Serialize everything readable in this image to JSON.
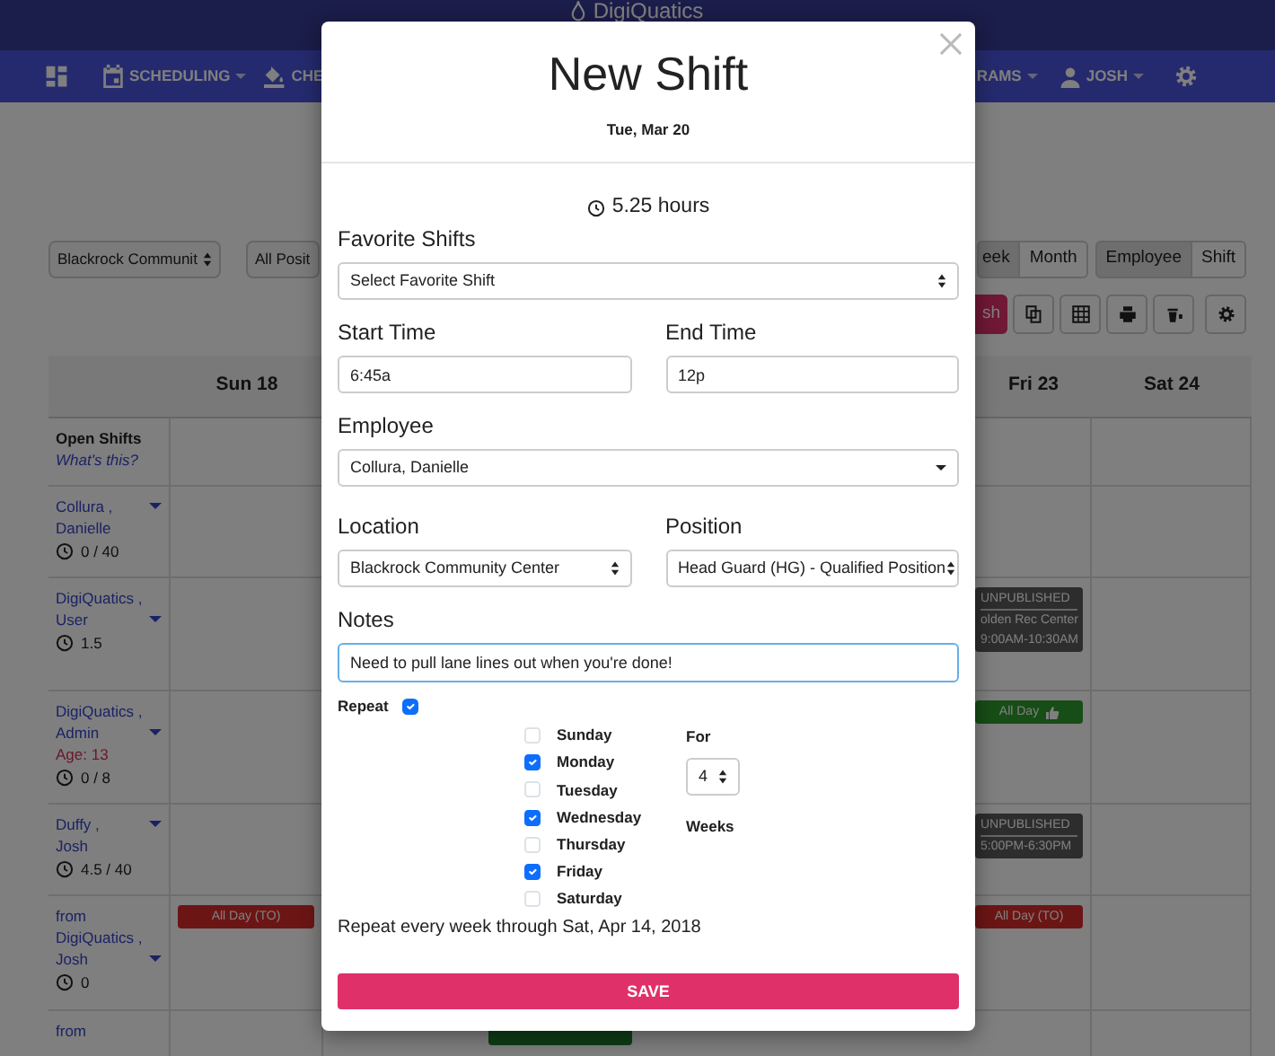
{
  "brand": "DigiQuatics",
  "nav": {
    "left": [
      {
        "label": "SCHEDULING",
        "dropdown": true
      },
      {
        "label": "CHE",
        "dropdown": false
      }
    ],
    "right": [
      {
        "label": "RAMS",
        "dropdown": true
      },
      {
        "label": "JOSH",
        "dropdown": true
      }
    ]
  },
  "filters": [
    {
      "value": "Blackrock Communit"
    },
    {
      "value": "All Posit"
    }
  ],
  "views": [
    {
      "label": "eek",
      "selected": true
    },
    {
      "label": "Month",
      "selected": false
    }
  ],
  "modes": [
    {
      "label": "Employee",
      "selected": true
    },
    {
      "label": "Shift",
      "selected": false
    }
  ],
  "publish": "sh",
  "table": {
    "columns": [
      "Sun 18",
      "Fri 23",
      "Sat 24"
    ],
    "open_shifts": {
      "label": "Open Shifts",
      "link": "What's this?"
    },
    "rows": [
      {
        "last": "Collura ,",
        "first": "Danielle",
        "dropdown": true,
        "hours": "0 / 40"
      },
      {
        "last": "DigiQuatics ,",
        "first": "User",
        "dropdown": true,
        "hours": "1.5",
        "fri": [
          {
            "kind": "unpublished",
            "lines": [
              "UNPUBLISHED",
              "olden Rec Center",
              "9:00AM-10:30AM"
            ]
          }
        ]
      },
      {
        "last": "DigiQuatics ,",
        "first": "Admin",
        "dropdown": true,
        "age": "Age: 13",
        "hours": "0 / 8",
        "fri": [
          {
            "kind": "approved",
            "lines": [
              "All Day"
            ]
          }
        ]
      },
      {
        "last": "Duffy ,",
        "first": "Josh",
        "dropdown": true,
        "hours": "4.5 / 40",
        "fri": [
          {
            "kind": "unpublished",
            "lines": [
              "UNPUBLISHED",
              "5:00PM-6:30PM"
            ]
          }
        ]
      },
      {
        "prefix": "from",
        "last": "DigiQuatics ,",
        "first": "Josh",
        "dropdown": true,
        "hours": "0",
        "sun": [
          {
            "kind": "timeoff",
            "lines": [
              "All Day (TO)"
            ]
          }
        ],
        "fri": [
          {
            "kind": "timeoff",
            "lines": [
              "All Day (TO)"
            ]
          }
        ]
      },
      {
        "prefix": "from",
        "dropdown": false,
        "tue": [
          {
            "kind": "shift"
          }
        ]
      }
    ]
  },
  "modal": {
    "title": "New Shift",
    "date": "Tue, Mar 20",
    "hours": "5.25 hours",
    "favorite": {
      "label": "Favorite Shifts",
      "value": "Select Favorite Shift"
    },
    "start": {
      "label": "Start Time",
      "value": "6:45a"
    },
    "end": {
      "label": "End Time",
      "value": "12p"
    },
    "employee": {
      "label": "Employee",
      "value": "Collura, Danielle"
    },
    "location": {
      "label": "Location",
      "value": "Blackrock Community Center"
    },
    "position": {
      "label": "Position",
      "value": "Head Guard (HG) - Qualified Position"
    },
    "notes": {
      "label": "Notes",
      "value": "Need to pull lane lines out when you're done!",
      "focused": true
    },
    "repeat": {
      "label": "Repeat",
      "checked": true,
      "days": [
        {
          "label": "Sunday",
          "checked": false
        },
        {
          "label": "Monday",
          "checked": true
        },
        {
          "label": "Tuesday",
          "checked": false
        },
        {
          "label": "Wednesday",
          "checked": true
        },
        {
          "label": "Thursday",
          "checked": false
        },
        {
          "label": "Friday",
          "checked": true
        },
        {
          "label": "Saturday",
          "checked": false
        }
      ],
      "for_label": "For",
      "weeks": "4",
      "weeks_label": "Weeks",
      "summary": "Repeat every week through Sat, Apr 14, 2018"
    },
    "save": "SAVE"
  }
}
